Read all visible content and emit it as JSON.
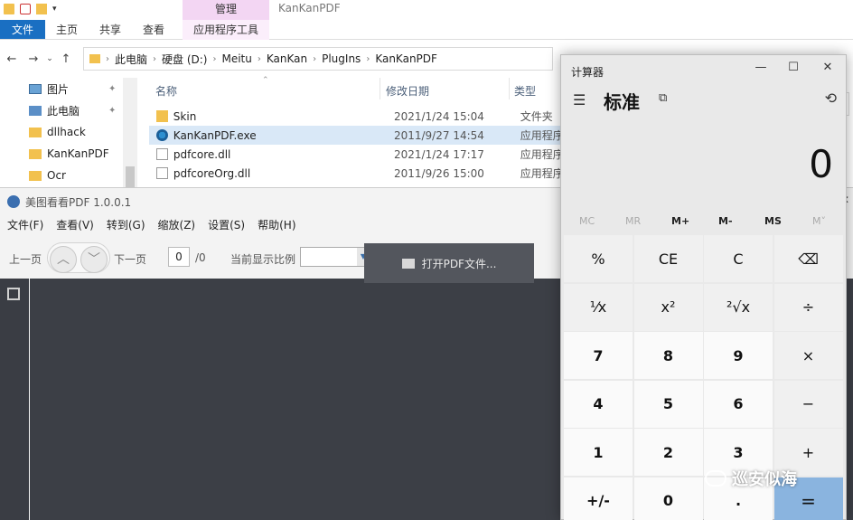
{
  "explorer": {
    "window_title": "KanKanPDF",
    "context_tab": "管理",
    "ribbon_tabs": [
      "文件",
      "主页",
      "共享",
      "查看"
    ],
    "context_ribbon_tab": "应用程序工具",
    "breadcrumb": [
      "此电脑",
      "硬盘 (D:)",
      "Meitu",
      "KanKan",
      "PlugIns",
      "KanKanPDF"
    ],
    "sidebar": [
      {
        "label": "图片",
        "icon": "picture-icon"
      },
      {
        "label": "此电脑",
        "icon": "computer-icon"
      },
      {
        "label": "dllhack",
        "icon": "folder-icon"
      },
      {
        "label": "KanKanPDF",
        "icon": "folder-icon"
      },
      {
        "label": "Ocr",
        "icon": "folder-icon"
      }
    ],
    "columns": {
      "name": "名称",
      "date": "修改日期",
      "type": "类型"
    },
    "files": [
      {
        "name": "Skin",
        "date": "2021/1/24 15:04",
        "type": "文件夹",
        "icon": "folder-icon",
        "selected": false
      },
      {
        "name": "KanKanPDF.exe",
        "date": "2011/9/27 14:54",
        "type": "应用程序",
        "icon": "exe-icon",
        "selected": true
      },
      {
        "name": "pdfcore.dll",
        "date": "2021/1/24 17:17",
        "type": "应用程序扩",
        "icon": "dll-icon",
        "selected": false
      },
      {
        "name": "pdfcoreOrg.dll",
        "date": "2011/9/26 15:00",
        "type": "应用程序扩",
        "icon": "dll-icon",
        "selected": false
      }
    ]
  },
  "pdf": {
    "title": "美图看看PDF 1.0.0.1",
    "menu": [
      "文件(F)",
      "查看(V)",
      "转到(G)",
      "缩放(Z)",
      "设置(S)",
      "帮助(H)"
    ],
    "prev_page": "上一页",
    "next_page": "下一页",
    "page_value": "0",
    "page_total": "/0",
    "zoom_label": "当前显示比例",
    "open_button": "打开PDF文件..."
  },
  "calc": {
    "title": "计算器",
    "mode": "标准",
    "display": "0",
    "memory": [
      "MC",
      "MR",
      "M+",
      "M-",
      "MS",
      "M˅"
    ],
    "memory_enabled": [
      false,
      false,
      true,
      true,
      true,
      false
    ],
    "keys": [
      [
        "%",
        "CE",
        "C",
        "⌫"
      ],
      [
        "¹⁄x",
        "x²",
        "²√x",
        "÷"
      ],
      [
        "7",
        "8",
        "9",
        "×"
      ],
      [
        "4",
        "5",
        "6",
        "−"
      ],
      [
        "1",
        "2",
        "3",
        "+"
      ],
      [
        "+/-",
        "0",
        ".",
        "="
      ]
    ]
  },
  "watermark": "巡安似海"
}
